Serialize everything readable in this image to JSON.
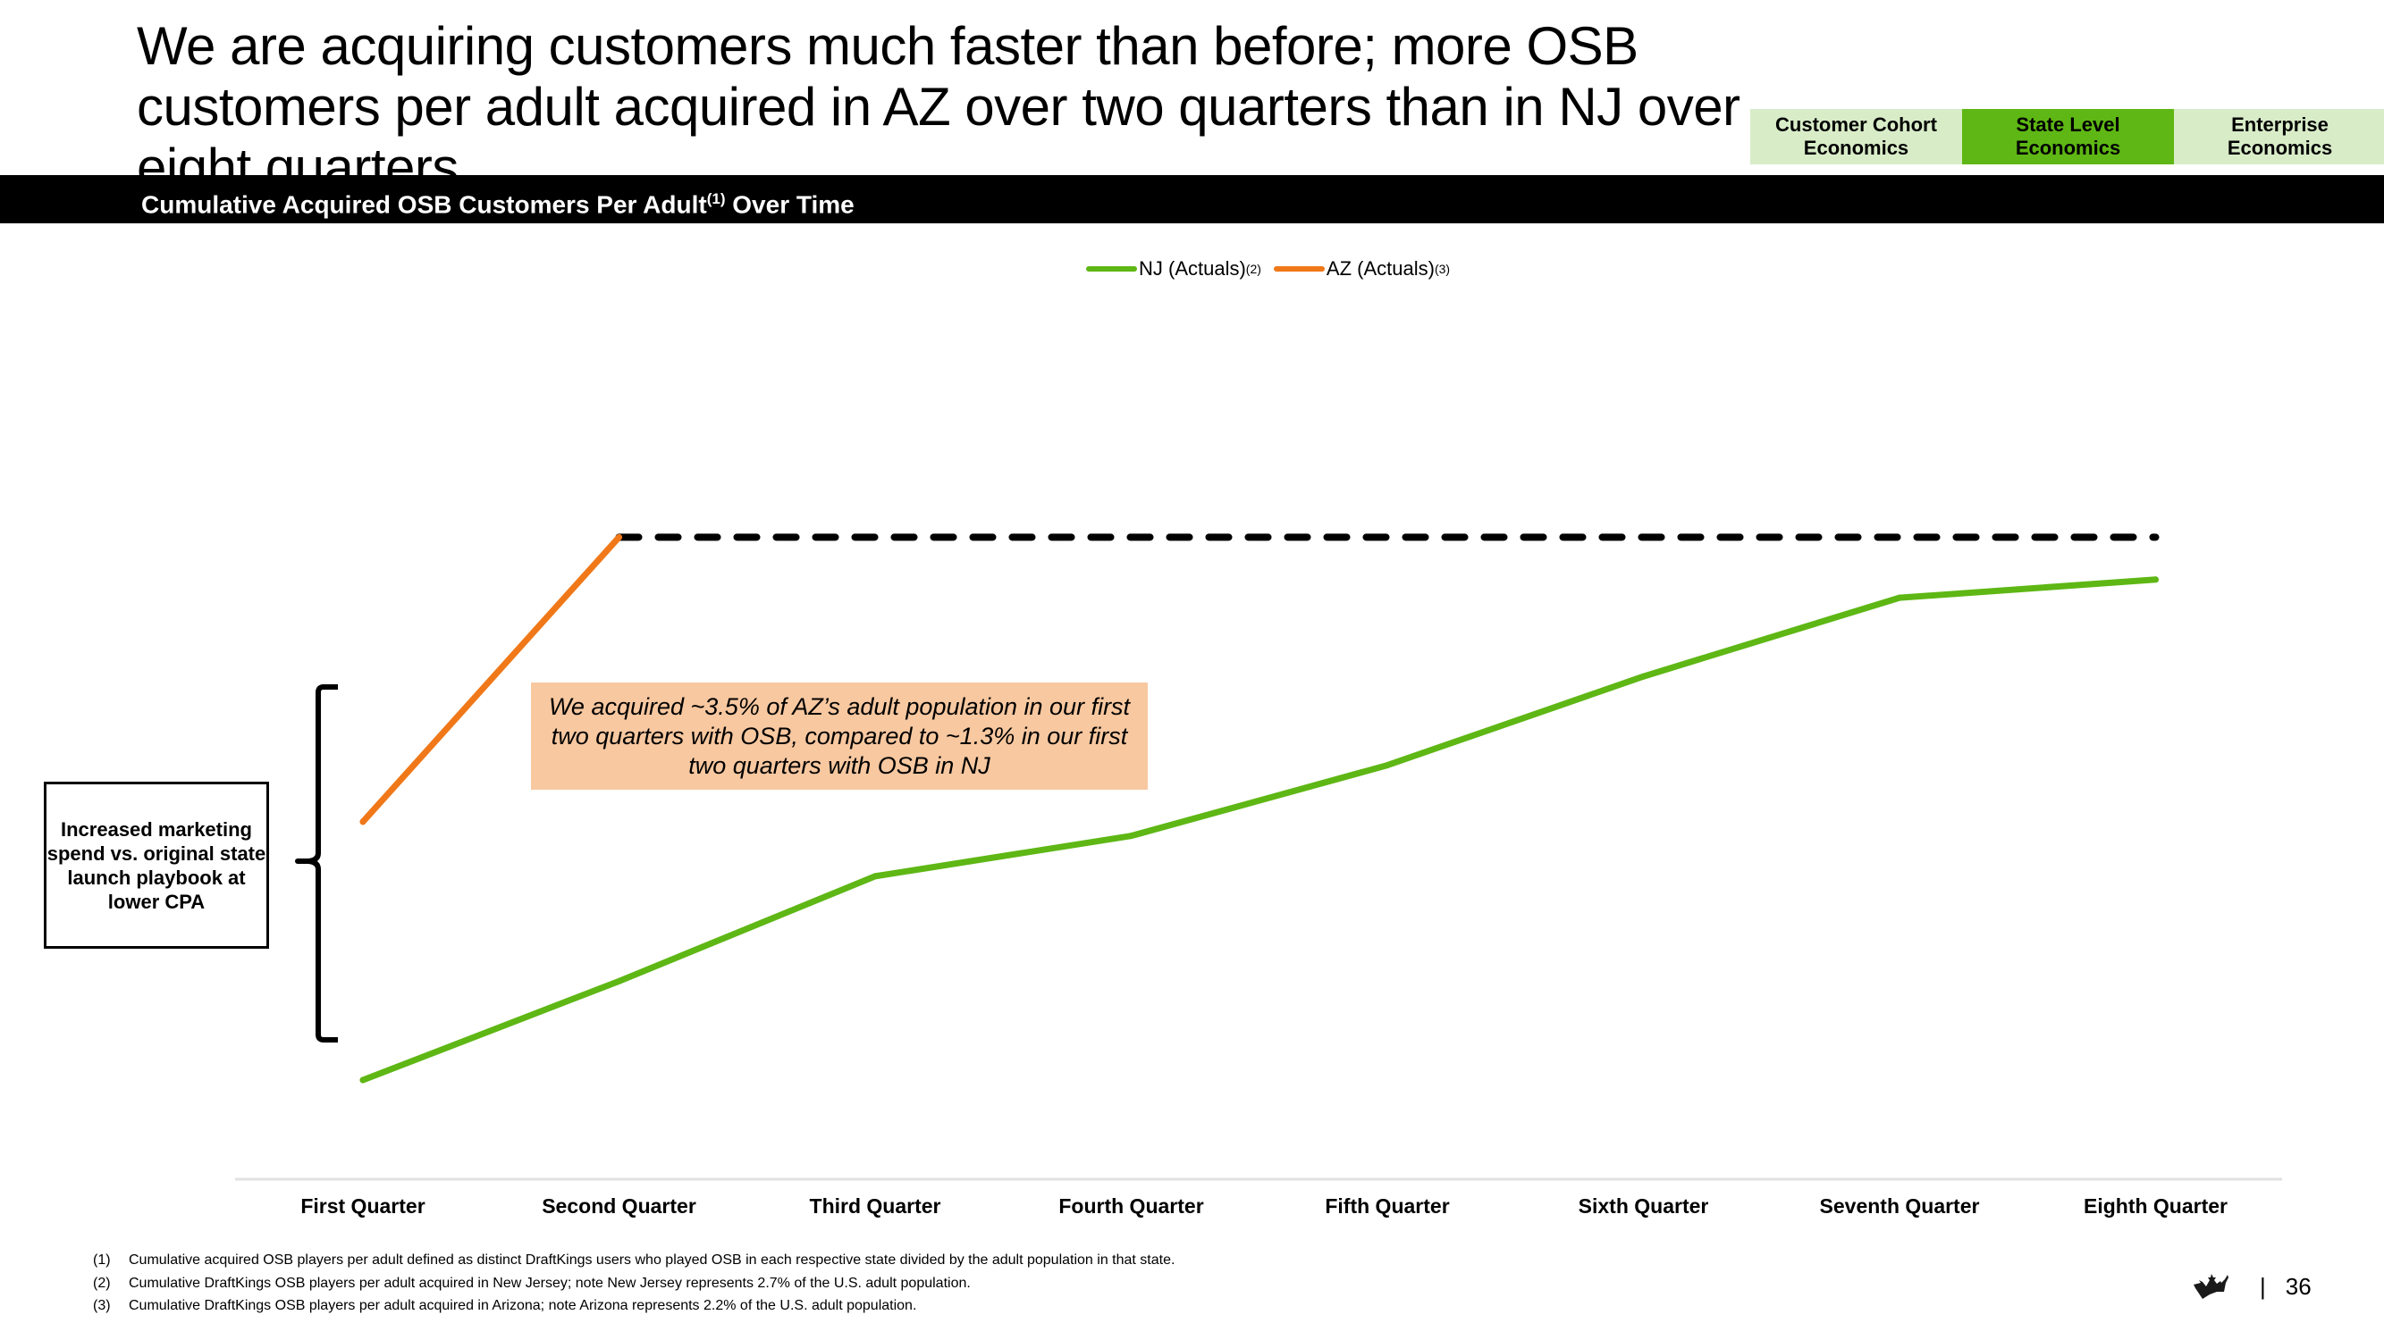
{
  "header": {
    "title": "We are acquiring customers much faster than before; more OSB customers per adult acquired in AZ over two quarters than in NJ over eight quarters",
    "nav_tabs": [
      {
        "label": "Customer Cohort\nEconomics",
        "active": false
      },
      {
        "label": "State Level\nEconomics",
        "active": true
      },
      {
        "label": "Enterprise\nEconomics",
        "active": false
      }
    ]
  },
  "section": {
    "title": "Cumulative Acquired OSB Customers Per Adult",
    "title_sup": "(1)",
    "title_suffix": " Over Time"
  },
  "legend": [
    {
      "label": "NJ (Actuals)",
      "sup": "(2)",
      "color": "#5eb714"
    },
    {
      "label": "AZ (Actuals)",
      "sup": "(3)",
      "color": "#f07818"
    }
  ],
  "callout": {
    "text": "We acquired ~3.5% of AZ’s adult population in our first two quarters with OSB, compared to ~1.3% in our first two quarters with OSB in NJ"
  },
  "note_box": {
    "text": "Increased marketing spend vs. original state launch playbook at lower CPA"
  },
  "chart_data": {
    "type": "line",
    "title": "Cumulative Acquired OSB Customers Per Adult Over Time",
    "xlabel": "",
    "ylabel": "Cumulative acquired OSB customers per adult (%, estimated; no y-axis shown)",
    "categories": [
      "First Quarter",
      "Second Quarter",
      "Third Quarter",
      "Fourth Quarter",
      "Fifth Quarter",
      "Sixth Quarter",
      "Seventh Quarter",
      "Eighth Quarter"
    ],
    "series": [
      {
        "name": "NJ (Actuals)",
        "color": "#5eb714",
        "values": [
          0.81,
          1.3,
          1.82,
          2.02,
          2.37,
          2.81,
          3.2,
          3.29
        ]
      },
      {
        "name": "AZ (Actuals)",
        "color": "#f07818",
        "values": [
          2.09,
          3.5,
          null,
          null,
          null,
          null,
          null,
          null
        ]
      }
    ],
    "reference_line": {
      "style": "dashed",
      "color": "#000000",
      "value": 3.5,
      "from_category": "Second Quarter",
      "to_category": "Eighth Quarter"
    },
    "annotations": [
      "We acquired ~3.5% of AZ’s adult population in our first two quarters with OSB, compared to ~1.3% in our first two quarters with OSB in NJ",
      "Increased marketing spend vs. original state launch playbook at lower CPA"
    ],
    "ylim": [
      0,
      4.1
    ],
    "grid": false,
    "legend_position": "top-center"
  },
  "footnotes": [
    {
      "num": "(1)",
      "text": "Cumulative acquired OSB players per adult defined as distinct DraftKings users who played OSB in each respective state divided by the adult population in that state."
    },
    {
      "num": "(2)",
      "text": "Cumulative DraftKings OSB players per adult acquired in New Jersey; note New Jersey represents 2.7% of the U.S. adult population."
    },
    {
      "num": "(3)",
      "text": "Cumulative DraftKings OSB players per adult acquired in Arizona; note Arizona represents 2.2% of the U.S. adult population."
    }
  ],
  "footer": {
    "logo": "crown-icon",
    "separator": "|",
    "page_number": "36"
  }
}
